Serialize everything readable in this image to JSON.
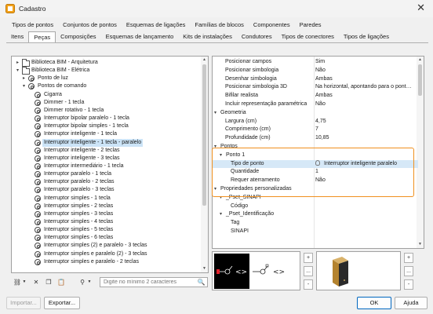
{
  "window": {
    "title": "Cadastro",
    "close_glyph": "✕"
  },
  "tabs_top": [
    "Tipos de pontos",
    "Conjuntos de pontos",
    "Esquemas de ligações",
    "Famílias de blocos",
    "Componentes",
    "Paredes"
  ],
  "tabs_second": [
    {
      "label": "Itens",
      "active": false
    },
    {
      "label": "Peças",
      "active": true
    },
    {
      "label": "Composições",
      "active": false
    },
    {
      "label": "Esquemas de lançamento",
      "active": false
    },
    {
      "label": "Kits de instalações",
      "active": false
    },
    {
      "label": "Condutores",
      "active": false
    },
    {
      "label": "Tipos de conectores",
      "active": false
    },
    {
      "label": "Tipos de ligações",
      "active": false
    }
  ],
  "tree": {
    "items": [
      {
        "label": "Biblioteca BIM - Arquitetura",
        "level": 0,
        "icon": "folder-icon",
        "arrow": "collapsed"
      },
      {
        "label": "Biblioteca BIM - Elétrica",
        "level": 0,
        "icon": "folder-icon",
        "arrow": "expanded"
      },
      {
        "label": "Ponto de luz",
        "level": 1,
        "icon": "target-icon",
        "arrow": "collapsed"
      },
      {
        "label": "Pontos de comando",
        "level": 1,
        "icon": "target-icon",
        "arrow": "expanded"
      },
      {
        "label": "Cigarra",
        "level": 2,
        "icon": "target-icon",
        "arrow": ""
      },
      {
        "label": "Dimmer - 1 tecla",
        "level": 2,
        "icon": "target-icon",
        "arrow": ""
      },
      {
        "label": "Dimmer rotativo - 1 tecla",
        "level": 2,
        "icon": "target-icon",
        "arrow": ""
      },
      {
        "label": "Interruptor bipolar paralelo - 1 tecla",
        "level": 2,
        "icon": "target-icon",
        "arrow": ""
      },
      {
        "label": "Interruptor bipolar simples - 1 tecla",
        "level": 2,
        "icon": "target-icon",
        "arrow": ""
      },
      {
        "label": "Interruptor inteligente - 1 tecla",
        "level": 2,
        "icon": "target-icon",
        "arrow": ""
      },
      {
        "label": "Interruptor inteligente - 1 tecla - paralelo",
        "level": 2,
        "icon": "target-icon",
        "arrow": "",
        "selected": true
      },
      {
        "label": "Interruptor inteligente - 2 teclas",
        "level": 2,
        "icon": "target-icon",
        "arrow": ""
      },
      {
        "label": "Interruptor inteligente - 3 teclas",
        "level": 2,
        "icon": "target-icon",
        "arrow": ""
      },
      {
        "label": "Interruptor intermediário - 1 tecla",
        "level": 2,
        "icon": "target-icon",
        "arrow": ""
      },
      {
        "label": "Interruptor paralelo - 1 tecla",
        "level": 2,
        "icon": "target-icon",
        "arrow": ""
      },
      {
        "label": "Interruptor paralelo - 2 teclas",
        "level": 2,
        "icon": "target-icon",
        "arrow": ""
      },
      {
        "label": "Interruptor paralelo - 3 teclas",
        "level": 2,
        "icon": "target-icon",
        "arrow": ""
      },
      {
        "label": "Interruptor simples - 1 tecla",
        "level": 2,
        "icon": "target-icon",
        "arrow": ""
      },
      {
        "label": "Interruptor simples - 2 teclas",
        "level": 2,
        "icon": "target-icon",
        "arrow": ""
      },
      {
        "label": "Interruptor simples - 3 teclas",
        "level": 2,
        "icon": "target-icon",
        "arrow": ""
      },
      {
        "label": "Interruptor simples - 4 teclas",
        "level": 2,
        "icon": "target-icon",
        "arrow": ""
      },
      {
        "label": "Interruptor simples - 5 teclas",
        "level": 2,
        "icon": "target-icon",
        "arrow": ""
      },
      {
        "label": "Interruptor simples - 6 teclas",
        "level": 2,
        "icon": "target-icon",
        "arrow": ""
      },
      {
        "label": "Interruptor simples (2) e paralelo - 3 teclas",
        "level": 2,
        "icon": "target-icon",
        "arrow": ""
      },
      {
        "label": "Interruptor simples e paralelo (2) - 3 teclas",
        "level": 2,
        "icon": "target-icon",
        "arrow": ""
      },
      {
        "label": "Interruptor simples e paralelo - 2 teclas",
        "level": 2,
        "icon": "target-icon",
        "arrow": ""
      }
    ]
  },
  "search": {
    "placeholder": "Digite no mínimo 2 caracteres",
    "value": ""
  },
  "props": {
    "rows": [
      {
        "label": "Posicionar campos",
        "value": "Sim",
        "level": 2,
        "type": "prop"
      },
      {
        "label": "Posicionar simbologia",
        "value": "Não",
        "level": 2,
        "type": "prop"
      },
      {
        "label": "Desenhar simbologia",
        "value": "Ambas",
        "level": 2,
        "type": "prop"
      },
      {
        "label": "Posicionar simbologia 3D",
        "value": "Na horizontal, apontando para o pont…",
        "level": 2,
        "type": "prop"
      },
      {
        "label": "Bifilar realista",
        "value": "Ambas",
        "level": 2,
        "type": "prop"
      },
      {
        "label": "Incluir representação paramétrica",
        "value": "Não",
        "level": 2,
        "type": "prop"
      },
      {
        "label": "Geometria",
        "value": "",
        "level": 0,
        "type": "group"
      },
      {
        "label": "Largura (cm)",
        "value": "4,75",
        "level": 2,
        "type": "prop"
      },
      {
        "label": "Comprimento (cm)",
        "value": "7",
        "level": 2,
        "type": "prop"
      },
      {
        "label": "Profundidade (cm)",
        "value": "10,85",
        "level": 2,
        "type": "prop"
      },
      {
        "label": "Pontos",
        "value": "",
        "level": 0,
        "type": "group"
      },
      {
        "label": "Ponto 1",
        "value": "",
        "level": 1,
        "type": "group"
      },
      {
        "label": "Tipo de ponto",
        "value": "Interruptor inteligente paralelo",
        "level": 3,
        "type": "prop",
        "highlight": true,
        "value_icon": "lightbulb-icon"
      },
      {
        "label": "Quantidade",
        "value": "1",
        "level": 3,
        "type": "prop"
      },
      {
        "label": "Requer aterramento",
        "value": "Não",
        "level": 3,
        "type": "prop"
      },
      {
        "label": "Propriedades personalizadas",
        "value": "",
        "level": 0,
        "type": "group"
      },
      {
        "label": "_Pset_SINAPI",
        "value": "",
        "level": 1,
        "type": "group"
      },
      {
        "label": "Código",
        "value": "",
        "level": 3,
        "type": "prop"
      },
      {
        "label": "_Pset_Identificação",
        "value": "",
        "level": 1,
        "type": "group"
      },
      {
        "label": "Tag",
        "value": "",
        "level": 3,
        "type": "prop"
      },
      {
        "label": "SINAPI",
        "value": "",
        "level": 3,
        "type": "prop"
      }
    ]
  },
  "symbol_glyph": "<>",
  "side_buttons": {
    "add": "+",
    "more": "...",
    "remove": "-"
  },
  "footer": {
    "import_label": "Importar...",
    "export_label": "Exportar...",
    "ok_label": "OK",
    "help_label": "Ajuda"
  },
  "colors": {
    "accent": "#0067c0",
    "highlight_border": "#f0901e",
    "selection": "#cce4f7",
    "red_marker": "#e0202a",
    "box_body": "#b4832f"
  }
}
